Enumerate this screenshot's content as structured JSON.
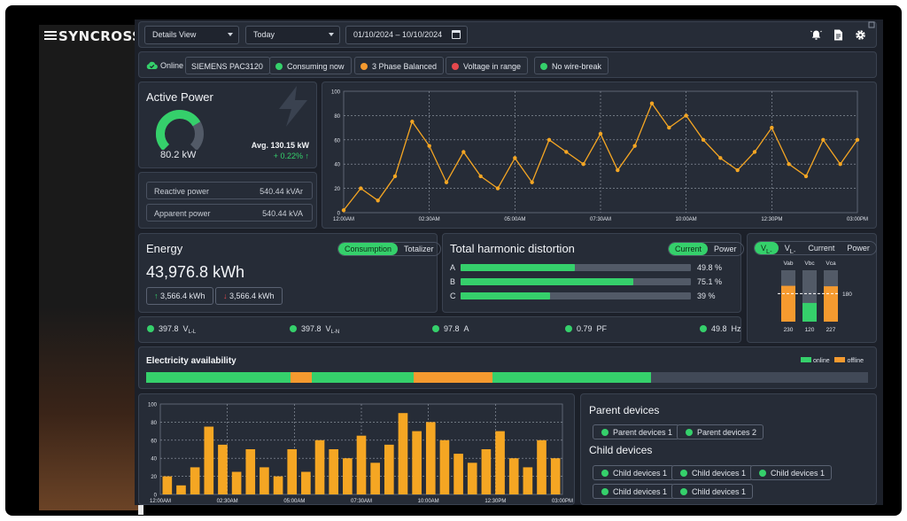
{
  "brand": {
    "name": "SYNCROSS"
  },
  "topbar": {
    "view_select": "Details View",
    "period_select": "Today",
    "date_range": "01/10/2024  –  10/10/2024",
    "icons": [
      "alarm-bell-icon",
      "report-document-icon",
      "settings-gear-icon"
    ]
  },
  "status": {
    "online_label": "Online",
    "device_name": "SIEMENS  PAC3120",
    "chips": [
      {
        "label": "Consuming now",
        "color": "#35d06b"
      },
      {
        "label": "3 Phase Balanced",
        "color": "#f59a2f"
      },
      {
        "label": "Voltage in range",
        "color": "#e5484d"
      },
      {
        "label": "No wire-break",
        "color": "#35d06b"
      }
    ]
  },
  "active_power": {
    "title": "Active Power",
    "value": "80.2 kW",
    "gauge_fraction": 0.72,
    "avg_label": "Avg. 130.15 kW",
    "change": "+ 0.22%",
    "reactive_label": "Reactive power",
    "reactive_value": "540.44 kVAr",
    "apparent_label": "Apparent power",
    "apparent_value": "540.44 kVA"
  },
  "energy": {
    "title": "Energy",
    "tabs": [
      "Consumption",
      "Totalizer"
    ],
    "value": "43,976.8 kWh",
    "up_value": "3,566.4 kWh",
    "down_value": "3,566.4 kWh"
  },
  "thd": {
    "title": "Total harmonic distortion",
    "tabs": [
      "Current",
      "Power"
    ],
    "rows": [
      {
        "label": "A",
        "value": 49.8,
        "text": "49.8 %"
      },
      {
        "label": "B",
        "value": 75.1,
        "text": "75.1 %"
      },
      {
        "label": "C",
        "value": 39,
        "text": "39 %"
      }
    ]
  },
  "phases": {
    "tabs": [
      "VL-L",
      "VL-N",
      "Current",
      "Power"
    ],
    "bars": [
      {
        "label": "Vab",
        "value": 230,
        "color": "#f59a2f"
      },
      {
        "label": "Vbc",
        "value": 120,
        "color": "#35d06b"
      },
      {
        "label": "Vca",
        "value": 227,
        "color": "#f59a2f"
      }
    ],
    "max": 330,
    "threshold": 180,
    "threshold_label": "180"
  },
  "readings": [
    {
      "value": "397.8",
      "unit": "V",
      "sub": "L-L"
    },
    {
      "value": "397.8",
      "unit": "V",
      "sub": "L-N"
    },
    {
      "value": "97.8",
      "unit": "A",
      "sub": ""
    },
    {
      "value": "0.79",
      "unit": "PF",
      "sub": ""
    },
    {
      "value": "49.8",
      "unit": "Hz",
      "sub": ""
    }
  ],
  "availability": {
    "title": "Electricity availability",
    "legend": [
      {
        "label": "online",
        "color": "#35d06b"
      },
      {
        "label": "offline",
        "color": "#f59a2f"
      }
    ],
    "segments": [
      {
        "state": "online",
        "fraction": 0.2
      },
      {
        "state": "offline",
        "fraction": 0.03
      },
      {
        "state": "online",
        "fraction": 0.14
      },
      {
        "state": "offline",
        "fraction": 0.11
      },
      {
        "state": "online",
        "fraction": 0.22
      },
      {
        "state": "none",
        "fraction": 0.3
      }
    ]
  },
  "devices": {
    "parent_title": "Parent devices",
    "parents": [
      "Parent devices 1",
      "Parent devices 2"
    ],
    "child_title": "Child devices",
    "children": [
      "Child devices 1",
      "Child devices 1",
      "Child devices 1",
      "Child devices 1",
      "Child devices 1"
    ]
  },
  "chart_data": [
    {
      "type": "line",
      "color": "#f5a623",
      "ylim": [
        0,
        100
      ],
      "yticks": [
        0,
        20,
        40,
        60,
        80,
        100
      ],
      "xtick_labels": [
        "12:00AM",
        "02:30AM",
        "05:00AM",
        "07:30AM",
        "10:00AM",
        "12:30PM",
        "03:00PM"
      ],
      "values": [
        2,
        20,
        10,
        30,
        75,
        55,
        25,
        50,
        30,
        20,
        45,
        25,
        60,
        50,
        40,
        65,
        35,
        55,
        90,
        70,
        80,
        60,
        45,
        35,
        50,
        70,
        40,
        30,
        60,
        40,
        60
      ],
      "grid": true
    },
    {
      "type": "bar",
      "color": "#f5a623",
      "ylim": [
        0,
        100
      ],
      "yticks": [
        0,
        20,
        40,
        60,
        80,
        100
      ],
      "xtick_labels": [
        "12:00AM",
        "02:30AM",
        "05:00AM",
        "07:30AM",
        "10:00AM",
        "12:30PM",
        "03:00PM"
      ],
      "values": [
        20,
        10,
        30,
        75,
        55,
        25,
        50,
        30,
        20,
        50,
        25,
        60,
        50,
        40,
        65,
        35,
        55,
        90,
        70,
        80,
        60,
        45,
        35,
        50,
        70,
        40,
        30,
        60,
        40
      ],
      "grid": true
    }
  ]
}
